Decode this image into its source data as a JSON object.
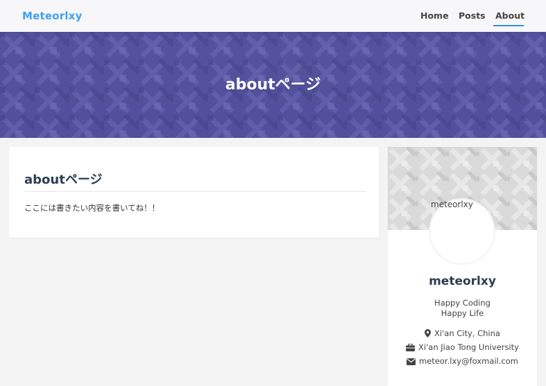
{
  "navbar": {
    "brand": "Meteorlxy",
    "links": [
      {
        "label": "Home"
      },
      {
        "label": "Posts"
      },
      {
        "label": "About"
      }
    ],
    "active_color": "#2e8ee0",
    "brand_color": "#3ea0f0"
  },
  "hero": {
    "title": "aboutページ",
    "background_color": "#5a58a0"
  },
  "content": {
    "title": "aboutページ",
    "body": "ここには書きたい内容を書いてね！！"
  },
  "profile": {
    "avatar_alt": "meteorlxy",
    "name": "meteorlxy",
    "bio_line1": "Happy Coding",
    "bio_line2": "Happy Life",
    "location": "Xi'an City, China",
    "organization": "Xi'an Jiao Tong University",
    "email": "meteor.lxy@foxmail.com",
    "icons": [
      "map-marker-icon",
      "briefcase-icon",
      "envelope-icon"
    ]
  }
}
